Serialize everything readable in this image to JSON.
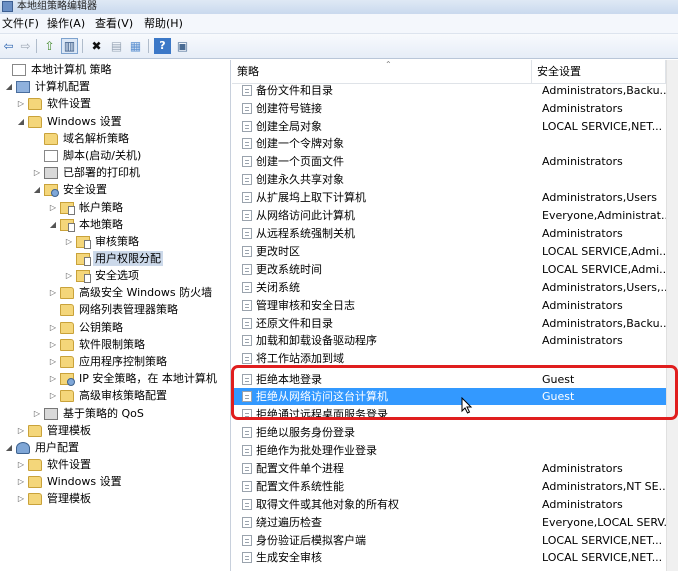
{
  "window": {
    "title": "本地组策略编辑器"
  },
  "menubar": {
    "items": [
      {
        "label": "文件(F)"
      },
      {
        "label": "操作(A)"
      },
      {
        "label": "查看(V)"
      },
      {
        "label": "帮助(H)"
      }
    ]
  },
  "toolbar": {
    "buttons": [
      {
        "icon": "back-arrow-icon",
        "glyph": "⇦"
      },
      {
        "icon": "forward-arrow-icon",
        "glyph": "⇨"
      },
      {
        "icon": "up-folder-icon",
        "glyph": "⇧"
      },
      {
        "icon": "show-hide-console-tree-icon",
        "glyph": "▥"
      },
      {
        "icon": "delete-icon",
        "glyph": "✖"
      },
      {
        "icon": "properties-icon",
        "glyph": "▤"
      },
      {
        "icon": "export-list-icon",
        "glyph": "▦"
      },
      {
        "icon": "help-icon",
        "glyph": "?"
      },
      {
        "icon": "toggle-pane-icon",
        "glyph": "▣"
      }
    ]
  },
  "tree": {
    "items": [
      {
        "label": "本地计算机 策略",
        "expander": "",
        "icon": "doc"
      },
      {
        "label": "计算机配置",
        "expander": "◢",
        "icon": "computer"
      },
      {
        "label": "软件设置",
        "expander": "▷",
        "icon": "folder"
      },
      {
        "label": "Windows 设置",
        "expander": "◢",
        "icon": "folder"
      },
      {
        "label": "域名解析策略",
        "expander": "",
        "icon": "folder"
      },
      {
        "label": "脚本(启动/关机)",
        "expander": "",
        "icon": "doc"
      },
      {
        "label": "已部署的打印机",
        "expander": "▷",
        "icon": "printer"
      },
      {
        "label": "安全设置",
        "expander": "◢",
        "icon": "security"
      },
      {
        "label": "帐户策略",
        "expander": "▷",
        "icon": "policy"
      },
      {
        "label": "本地策略",
        "expander": "◢",
        "icon": "policy"
      },
      {
        "label": "审核策略",
        "expander": "▷",
        "icon": "policy"
      },
      {
        "label": "用户权限分配",
        "expander": "",
        "icon": "policy"
      },
      {
        "label": "安全选项",
        "expander": "▷",
        "icon": "policy"
      },
      {
        "label": "高级安全 Windows 防火墙",
        "expander": "▷",
        "icon": "folder"
      },
      {
        "label": "网络列表管理器策略",
        "expander": "",
        "icon": "folder"
      },
      {
        "label": "公钥策略",
        "expander": "▷",
        "icon": "folder"
      },
      {
        "label": "软件限制策略",
        "expander": "▷",
        "icon": "folder"
      },
      {
        "label": "应用程序控制策略",
        "expander": "▷",
        "icon": "folder"
      },
      {
        "label": "IP 安全策略，在 本地计算机",
        "expander": "▷",
        "icon": "security"
      },
      {
        "label": "高级审核策略配置",
        "expander": "▷",
        "icon": "folder"
      },
      {
        "label": "基于策略的 QoS",
        "expander": "▷",
        "icon": "printer"
      },
      {
        "label": "管理模板",
        "expander": "▷",
        "icon": "folder"
      },
      {
        "label": "用户配置",
        "expander": "◢",
        "icon": "user"
      },
      {
        "label": "软件设置",
        "expander": "▷",
        "icon": "folder"
      },
      {
        "label": "Windows 设置",
        "expander": "▷",
        "icon": "folder"
      },
      {
        "label": "管理模板",
        "expander": "▷",
        "icon": "folder"
      }
    ]
  },
  "list": {
    "headers": {
      "policy": "策略",
      "setting": "安全设置"
    },
    "rows": [
      {
        "name": "备份文件和目录",
        "setting": "Administrators,Backu..."
      },
      {
        "name": "创建符号链接",
        "setting": "Administrators"
      },
      {
        "name": "创建全局对象",
        "setting": "LOCAL SERVICE,NET..."
      },
      {
        "name": "创建一个令牌对象",
        "setting": ""
      },
      {
        "name": "创建一个页面文件",
        "setting": "Administrators"
      },
      {
        "name": "创建永久共享对象",
        "setting": ""
      },
      {
        "name": "从扩展坞上取下计算机",
        "setting": "Administrators,Users"
      },
      {
        "name": "从网络访问此计算机",
        "setting": "Everyone,Administrat..."
      },
      {
        "name": "从远程系统强制关机",
        "setting": "Administrators"
      },
      {
        "name": "更改时区",
        "setting": "LOCAL SERVICE,Admi..."
      },
      {
        "name": "更改系统时间",
        "setting": "LOCAL SERVICE,Admi..."
      },
      {
        "name": "关闭系统",
        "setting": "Administrators,Users,..."
      },
      {
        "name": "管理审核和安全日志",
        "setting": "Administrators"
      },
      {
        "name": "还原文件和目录",
        "setting": "Administrators,Backu..."
      },
      {
        "name": "加载和卸载设备驱动程序",
        "setting": "Administrators"
      },
      {
        "name": "将工作站添加到域",
        "setting": ""
      },
      {
        "name": "拒绝本地登录",
        "setting": "Guest"
      },
      {
        "name": "拒绝从网络访问这台计算机",
        "setting": "Guest"
      },
      {
        "name": "拒绝通过远程桌面服务登录",
        "setting": ""
      },
      {
        "name": "拒绝以服务身份登录",
        "setting": ""
      },
      {
        "name": "拒绝作为批处理作业登录",
        "setting": ""
      },
      {
        "name": "配置文件单个进程",
        "setting": "Administrators"
      },
      {
        "name": "配置文件系统性能",
        "setting": "Administrators,NT SE..."
      },
      {
        "name": "取得文件或其他对象的所有权",
        "setting": "Administrators"
      },
      {
        "name": "绕过遍历检查",
        "setting": "Everyone,LOCAL SERV..."
      },
      {
        "name": "身份验证后模拟客户端",
        "setting": "LOCAL SERVICE,NET..."
      },
      {
        "name": "生成安全审核",
        "setting": "LOCAL SERVICE,NET..."
      }
    ]
  }
}
